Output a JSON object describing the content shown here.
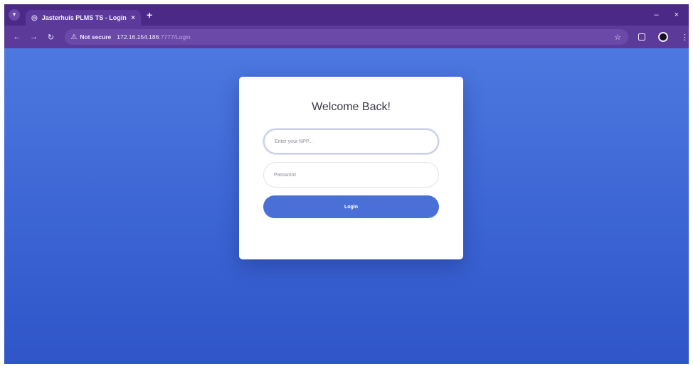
{
  "browser": {
    "tab": {
      "title": "Jasterhuis PLMS TS - Login",
      "favicon": "globe-icon",
      "close_glyph": "×"
    },
    "new_tab_glyph": "+",
    "window_controls": {
      "minimize": "–",
      "close": "×"
    },
    "address_bar": {
      "security_warning": "Not secure",
      "host": "172.16.154.186",
      "path": ":7777/Login"
    }
  },
  "login": {
    "title": "Welcome Back!",
    "id_placeholder": "Enter your NPP...",
    "password_placeholder": "Password",
    "submit_label": "Login"
  },
  "colors": {
    "browser_frame": "#4a2a86",
    "page_gradient_top": "#4d78df",
    "page_gradient_bottom": "#2f55c8",
    "button": "#4a70d8"
  }
}
